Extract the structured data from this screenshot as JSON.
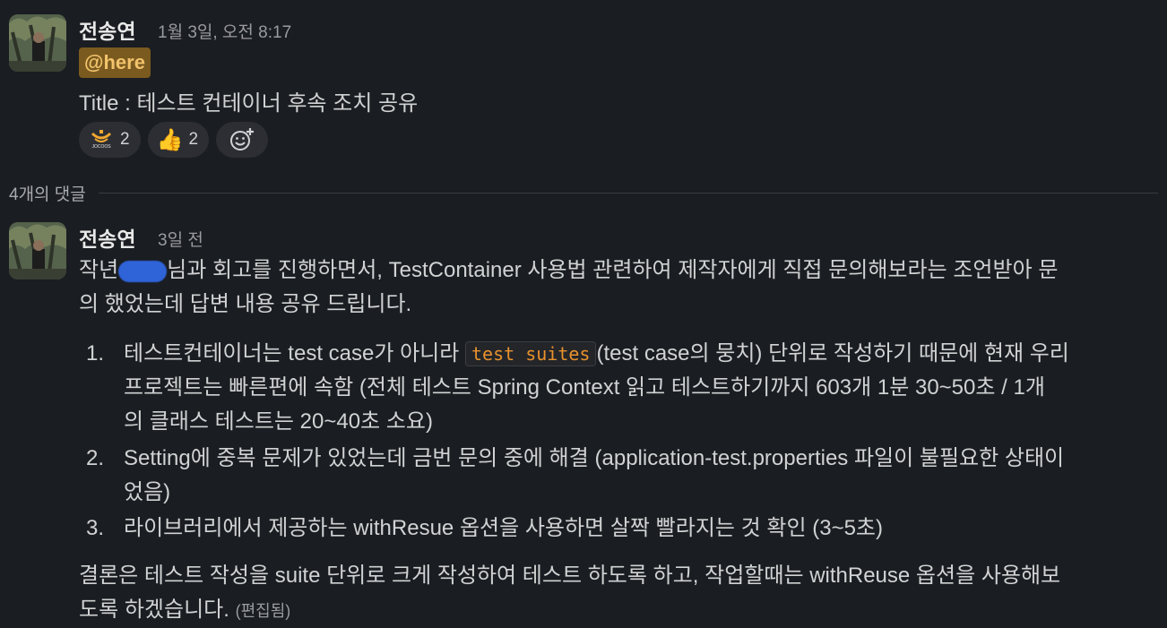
{
  "message1": {
    "author": "전송연",
    "timestamp": "1월 3일, 오전 8:17",
    "mention": "@here",
    "text": "Title : 테스트 컨테이너 후속 조치 공유",
    "reactions": [
      {
        "icon": "jocoos-logo-icon",
        "label": "JOCOOS",
        "count": "2"
      },
      {
        "icon": "thumbs-up-icon",
        "count": "2"
      }
    ],
    "add_reaction_icon": "add-emoji-icon"
  },
  "thread_divider": {
    "label": "4개의 댓글"
  },
  "message2": {
    "author": "전송연",
    "timestamp": "3일 전",
    "intro_line1_before": "작년",
    "intro_line1_after": "님과 회고를 진행하면서, TestContainer  사용법 관련하여 제작자에게 직접 문의해보라는 조언받아 문",
    "intro_line2": "의 했었는데 답변 내용 공유 드립니다.",
    "list": [
      {
        "num": "1.",
        "line1_before": "테스트컨테이너는 test case가 아니라 ",
        "code": "test suites",
        "line1_after": "(test case의 뭉치) 단위로 작성하기 때문에 현재 우리",
        "line2": "프로젝트는 빠른편에 속함 (전체 테스트 Spring Context 읽고 테스트하기까지 603개 1분 30~50초 / 1개",
        "line3": "의 클래스 테스트는 20~40초 소요)"
      },
      {
        "num": "2.",
        "line1": "Setting에 중복 문제가 있었는데 금번 문의 중에 해결 (application-test.properties 파일이 불필요한 상태이",
        "line2": "었음)"
      },
      {
        "num": "3.",
        "line1": "라이브러리에서 제공하는 withResue 옵션을 사용하면 살짝 빨라지는 것 확인 (3~5초)"
      }
    ],
    "conclusion_line1": "결론은 테스트 작성을 suite 단위로 크게 작성하여 테스트 하도록 하고, 작업할때는 withReuse 옵션을 사용해보",
    "conclusion_line2": "도록 하겠습니다.",
    "edited_label": "(편집됨)"
  },
  "colors": {
    "background": "#1a1d21",
    "mention_bg": "#7a5a1f",
    "mention_text": "#f2c36b",
    "code_text": "#e8912d",
    "reaction_bg": "#2c2e33"
  }
}
